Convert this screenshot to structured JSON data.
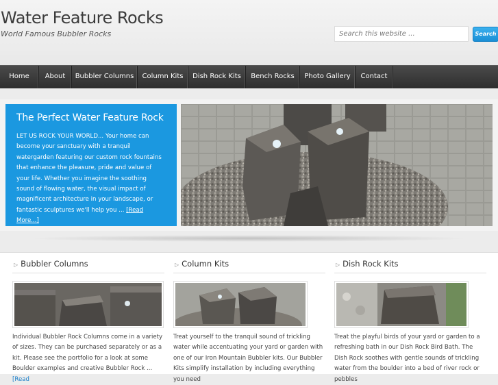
{
  "header": {
    "site_title": "Water Feature Rocks",
    "tagline": "World Famous Bubbler Rocks",
    "search_placeholder": "Search this website ...",
    "search_button": "Search"
  },
  "nav": {
    "items": [
      {
        "label": "Home"
      },
      {
        "label": "About"
      },
      {
        "label": "Bubbler Columns"
      },
      {
        "label": "Column Kits"
      },
      {
        "label": "Dish Rock Kits"
      },
      {
        "label": "Bench Rocks"
      },
      {
        "label": "Photo Gallery"
      },
      {
        "label": "Contact"
      }
    ]
  },
  "featured": {
    "title": "The Perfect Water Feature Rock",
    "text": "LET US ROCK YOUR WORLD... Your home can become your sanctuary with a tranquil watergarden featuring our custom rock fountains that enhance the pleasure, pride and value of your life. Whether you imagine the soothing sound of flowing water, the visual impact of magnificent architecture in your landscape, or fantastic sculptures we'll help you ...",
    "more": "[Read More...]"
  },
  "columns": [
    {
      "title": "Bubbler Columns",
      "text": "Individual Bubbler Rock Columns come in a variety of sizes. They can be purchased separately or as a kit. Please see the portfolio for a look at some Boulder examples and creative Bubbler Rock ... ",
      "more": "[Read"
    },
    {
      "title": "Column Kits",
      "text": "Treat yourself to the tranquil sound of trickling water while accentuating your yard or garden with one of our Iron Mountain Bubbler kits. Our Bubbler Kits simplify installation by including everything you need"
    },
    {
      "title": "Dish Rock Kits",
      "text": "Treat the playful birds of your yard or garden to a refreshing bath in our Dish Rock Bird Bath. The Dish Rock soothes with gentle sounds of trickling water from the boulder into a bed of river rock or pebbles"
    }
  ],
  "colors": {
    "accent": "#1b98e0",
    "nav_bg": "#333333",
    "link": "#1b7fc9"
  }
}
